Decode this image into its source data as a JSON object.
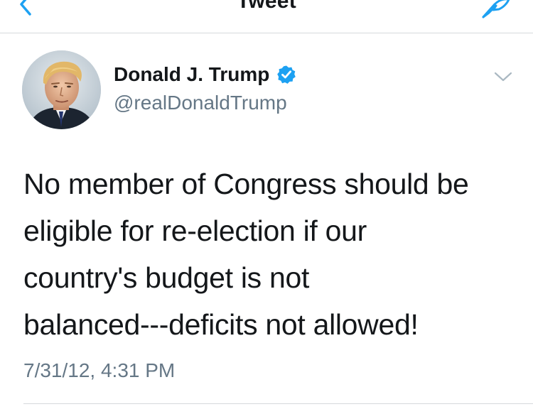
{
  "navbar": {
    "title": "Tweet",
    "back_icon": "chevron-left-icon",
    "compose_icon": "compose-feather-icon",
    "accent_color": "#1da1f2"
  },
  "tweet": {
    "author": {
      "name": "Donald J. Trump",
      "handle": "@realDonaldTrump",
      "verified": true,
      "verified_icon": "verified-badge-icon",
      "avatar": "avatar-photo"
    },
    "more_icon": "chevron-down-icon",
    "text_lines": [
      "No member of Congress should be",
      "eligible for re-election if our",
      "country's budget is not",
      "balanced---deficits not allowed!"
    ],
    "timestamp": "7/31/12, 4:31 PM"
  },
  "colors": {
    "text_primary": "#14171a",
    "text_secondary": "#657786",
    "divider": "#d6d9dc",
    "verified_blue": "#1da1f2",
    "chevron_grey": "#aab8c2"
  }
}
